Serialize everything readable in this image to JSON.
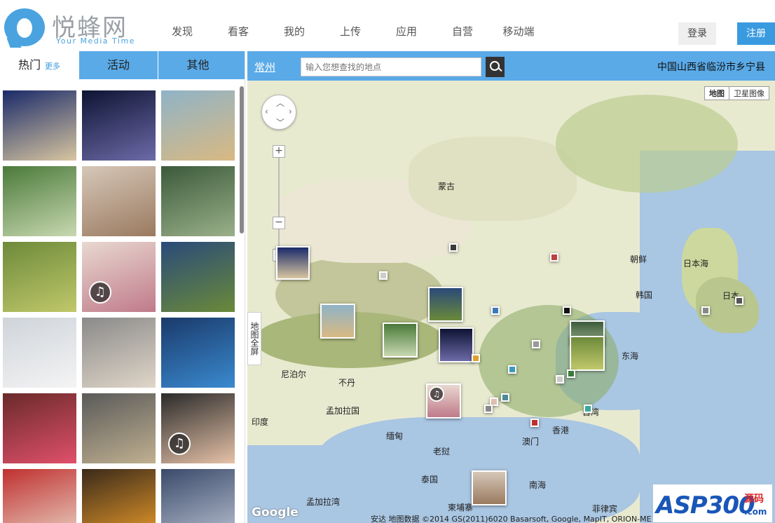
{
  "brand": {
    "name": "悦蜂网",
    "tagline": "Your Media Time"
  },
  "nav": [
    "发现",
    "看客",
    "我的",
    "上传",
    "应用",
    "自营",
    "移动端"
  ],
  "auth": {
    "login": "登录",
    "register": "注册"
  },
  "tabs": {
    "hot": "热门",
    "more": "更多",
    "activity": "活动",
    "other": "其他"
  },
  "map": {
    "city": "常州",
    "search_placeholder": "输入您想查找的地点",
    "location": "中国山西省临汾市乡宁县",
    "type_map": "地图",
    "type_satellite": "卫星图像",
    "fullscreen": "地图全屏",
    "labels": [
      "蒙古",
      "朝鲜",
      "韩国",
      "日本海",
      "日本",
      "东海",
      "尼泊尔",
      "不丹",
      "孟加拉国",
      "印度",
      "缅甸",
      "老挝",
      "泰国",
      "南海",
      "柬埔寨",
      "香港",
      "澳门",
      "台湾",
      "菲律宾",
      "孟加拉湾"
    ],
    "attribution": "安达  地图数据 ©2014 GS(2011)6020 Basarsoft, Google, MapIT, ORION-ME",
    "google": "Google"
  },
  "watermark": {
    "main": "ASP300",
    "sub1": "源码",
    "sub2": ".com"
  },
  "thumbnails": [
    {
      "desc": "mushroom-cloud",
      "c1": "#1a2a6a",
      "c2": "#d8c6a0",
      "music": false
    },
    {
      "desc": "night-sky",
      "c1": "#0e1433",
      "c2": "#6d6aa8",
      "music": false
    },
    {
      "desc": "beach-waves",
      "c1": "#8fb3c7",
      "c2": "#d9b982",
      "music": false
    },
    {
      "desc": "girl-garden",
      "c1": "#4a7a3a",
      "c2": "#c8d8b0",
      "music": false
    },
    {
      "desc": "monkey-cat",
      "c1": "#d6c7b8",
      "c2": "#9a7a60",
      "music": false
    },
    {
      "desc": "lake-trees",
      "c1": "#3b5a3a",
      "c2": "#9ab08a",
      "music": false
    },
    {
      "desc": "leaves",
      "c1": "#6d8a3a",
      "c2": "#c0c86a",
      "music": false
    },
    {
      "desc": "girl-pink",
      "c1": "#e8d8d0",
      "c2": "#c07a8a",
      "music": true
    },
    {
      "desc": "hill-landscape",
      "c1": "#2a4a7a",
      "c2": "#6a8a3a",
      "music": false
    },
    {
      "desc": "white-car",
      "c1": "#cfd4da",
      "c2": "#f4f4f4",
      "music": false
    },
    {
      "desc": "girl-street",
      "c1": "#8a8a8a",
      "c2": "#e0d6c8",
      "music": false
    },
    {
      "desc": "ipad-screen",
      "c1": "#1a3a6a",
      "c2": "#3a8ad0",
      "music": false
    },
    {
      "desc": "girl-red",
      "c1": "#6a2a2a",
      "c2": "#e0506a",
      "music": false
    },
    {
      "desc": "japan-street",
      "c1": "#5a5a5a",
      "c2": "#c0b090",
      "music": false
    },
    {
      "desc": "girl-portrait",
      "c1": "#2a2a2a",
      "c2": "#e6c2a8",
      "music": true
    },
    {
      "desc": "red-sofa",
      "c1": "#c03030",
      "c2": "#e8d0c0",
      "music": false
    },
    {
      "desc": "orange-car",
      "c1": "#3a2a1a",
      "c2": "#e89a2a",
      "music": false
    },
    {
      "desc": "police",
      "c1": "#3a4a6a",
      "c2": "#b8c0d0",
      "music": false
    }
  ]
}
